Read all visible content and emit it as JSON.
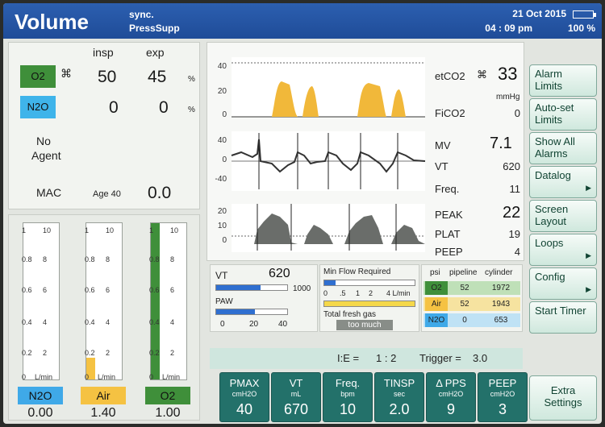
{
  "header": {
    "mode": "Volume",
    "submode_1": "sync.",
    "submode_2": "PressSupp",
    "date": "21  Oct  2015",
    "time": "04 : 09 pm",
    "battery": "100 %"
  },
  "gas_panel": {
    "insp_header": "insp",
    "exp_header": "exp",
    "o2_label": "O2",
    "o2_insp": "50",
    "o2_exp": "45",
    "o2_unit": "%",
    "n2o_label": "N2O",
    "n2o_insp": "0",
    "n2o_exp": "0",
    "n2o_unit": "%",
    "agent_line1": "No",
    "agent_line2": "Agent",
    "mac_label": "MAC",
    "age_label": "Age 40",
    "mac_value": "0.0"
  },
  "flow_meters": {
    "scale_labels_left": [
      "1",
      "0.8",
      "0.6",
      "0.4",
      "0.2",
      "0"
    ],
    "scale_labels_right": [
      "10",
      "8",
      "6",
      "4",
      "2",
      "L/min"
    ],
    "meters": [
      {
        "name": "N2O",
        "value": "0.00",
        "color": "#3fa9e8",
        "fill_fraction": 0.0
      },
      {
        "name": "Air",
        "value": "1.40",
        "color": "#f5c242",
        "fill_fraction": 0.14
      },
      {
        "name": "O2",
        "value": "1.00",
        "color": "#3f8f3a",
        "fill_fraction": 1.0
      }
    ]
  },
  "waveforms": {
    "co2_scale": [
      "40",
      "20",
      "0"
    ],
    "paw_scale": [
      "40",
      "0",
      "-40"
    ],
    "flow_scale": [
      "20",
      "10",
      "0"
    ],
    "etco2_label": "etCO2",
    "etco2_value": "33",
    "etco2_unit": "mmHg",
    "fico2_label": "FiCO2",
    "fico2_value": "0",
    "mv_label": "MV",
    "mv_value": "7.1",
    "vt_label": "VT",
    "vt_value": "620",
    "freq_label": "Freq.",
    "freq_value": "11",
    "peak_label": "PEAK",
    "peak_value": "22",
    "plat_label": "PLAT",
    "plat_value": "19",
    "peep_label": "PEEP",
    "peep_value": "4"
  },
  "vt_box": {
    "vt_label": "VT",
    "vt_value": "620",
    "vt_max": "1000",
    "vt_fraction": 0.62,
    "paw_label": "PAW",
    "paw_fraction": 0.55,
    "scale": [
      "0",
      "20",
      "40"
    ]
  },
  "fresh_gas": {
    "title": "Min Flow Required",
    "scale": [
      "0",
      ".5",
      "1",
      "2",
      "4 L/min"
    ],
    "label": "Total fresh gas",
    "status": "too much"
  },
  "pipeline": {
    "headers": [
      "psi",
      "pipeline",
      "cylinder"
    ],
    "rows": [
      {
        "gas": "O2",
        "pipeline": "52",
        "cylinder": "1972",
        "color": "#3f8f3a"
      },
      {
        "gas": "Air",
        "pipeline": "52",
        "cylinder": "1943",
        "color": "#f5c242"
      },
      {
        "gas": "N2O",
        "pipeline": "0",
        "cylinder": "653",
        "color": "#3fa9e8"
      }
    ]
  },
  "ratio": {
    "ie_label": "I:E =",
    "ie_value": "1 : 2",
    "trigger_label": "Trigger =",
    "trigger_value": "3.0"
  },
  "settings": [
    {
      "name": "PMAX",
      "unit": "cmH2O",
      "value": "40"
    },
    {
      "name": "VT",
      "unit": "mL",
      "value": "670"
    },
    {
      "name": "Freq.",
      "unit": "bpm",
      "value": "10"
    },
    {
      "name": "TINSP",
      "unit": "sec",
      "value": "2.0"
    },
    {
      "name": "Δ PPS",
      "unit": "cmH2O",
      "value": "9"
    },
    {
      "name": "PEEP",
      "unit": "cmH2O",
      "value": "3"
    }
  ],
  "extra_settings": "Extra Settings",
  "menu": {
    "alarm_limits": "Alarm Limits",
    "autoset_limits": "Auto-set Limits",
    "show_all_alarms": "Show All Alarms",
    "datalog": "Datalog",
    "screen_layout": "Screen Layout",
    "loops": "Loops",
    "config": "Config",
    "start_timer": "Start Timer"
  }
}
